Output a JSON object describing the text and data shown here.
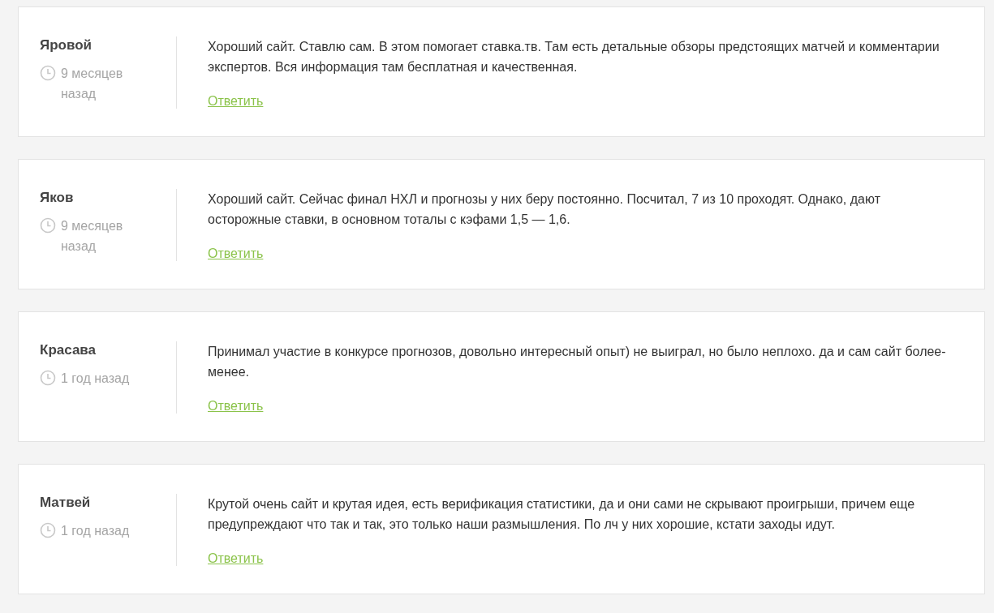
{
  "comments": [
    {
      "author": "Яровой",
      "time": "9 месяцев назад",
      "text": "Хороший сайт. Ставлю сам. В этом помогает ставка.тв. Там есть детальные обзоры предстоящих матчей и комментарии экспертов. Вся информация там бесплатная и качественная.",
      "reply": "Ответить"
    },
    {
      "author": "Яков",
      "time": "9 месяцев назад",
      "text": "Хороший сайт. Сейчас финал НХЛ и прогнозы у них беру постоянно. Посчитал, 7 из 10 проходят. Однако, дают осторожные ставки, в основном тоталы с кэфами 1,5 — 1,6.",
      "reply": "Ответить"
    },
    {
      "author": "Красава",
      "time": "1 год назад",
      "text": "Принимал участие в конкурсе прогнозов, довольно интересный опыт) не выиграл, но было неплохо. да и сам сайт более-менее.",
      "reply": "Ответить"
    },
    {
      "author": "Матвей",
      "time": "1 год назад",
      "text": "Крутой очень сайт и крутая идея, есть верификация статистики, да и они сами не скрывают проигрыши, причем еще предупреждают что так и так, это только наши размышления. По лч у них хорошие, кстати заходы идут.",
      "reply": "Ответить"
    }
  ]
}
